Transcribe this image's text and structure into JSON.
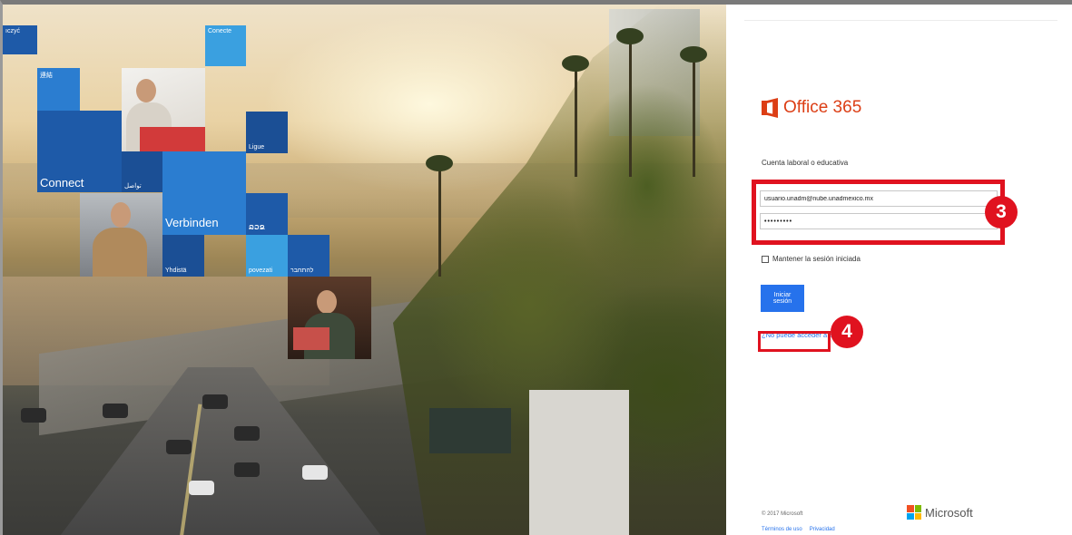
{
  "tiles": {
    "top_left": "ıczyć",
    "conecte": "Conecte",
    "cjk": "連結",
    "connect": "Connect",
    "arabic": "تواصل",
    "ligue": "Ligue",
    "verbinden": "Verbinden",
    "thai": "ລວຂ",
    "yhdista": "Yhdistä",
    "povezati": "povezati",
    "hebrew": "להתחבר"
  },
  "login": {
    "brand": "Office 365",
    "account_label": "Cuenta laboral o educativa",
    "email_value": "usuario.unadm@nube.unadmexico.mx",
    "password_value": "•••••••••",
    "remember_label": "Mantener la sesión iniciada",
    "signin_label": "Iniciar sesión",
    "cant_access_label": "¿No puede acceder a su cuenta?"
  },
  "annotations": {
    "step3": "3",
    "step4": "4"
  },
  "footer": {
    "copyright": "© 2017 Microsoft",
    "terms": "Términos de uso",
    "privacy": "Privacidad",
    "microsoft": "Microsoft"
  },
  "colors": {
    "office_orange": "#dc3e15",
    "signin_blue": "#2672ec",
    "annotation_red": "#e0121f",
    "tile_blue": "#1e5aa8",
    "tile_light_blue": "#3aa0e0"
  },
  "icons": [
    "office-logo-icon",
    "microsoft-logo-icon"
  ]
}
